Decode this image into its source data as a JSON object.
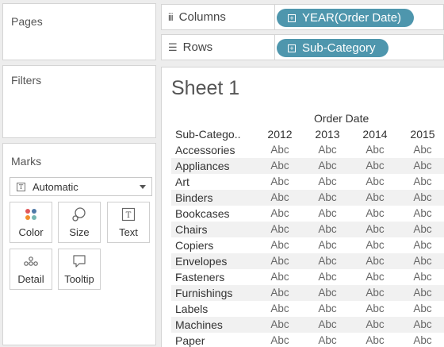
{
  "pages": {
    "title": "Pages"
  },
  "filters": {
    "title": "Filters"
  },
  "marks": {
    "title": "Marks",
    "mark_type": "Automatic",
    "buttons": [
      "Color",
      "Size",
      "Text",
      "Detail",
      "Tooltip"
    ]
  },
  "shelves": {
    "columns_label": "Columns",
    "columns_pill": "YEAR(Order Date)",
    "rows_label": "Rows",
    "rows_pill": "Sub-Category",
    "pill_color": "#4e96ad"
  },
  "view": {
    "sheet_title": "Sheet 1",
    "column_group_header": "Order Date",
    "row_header": "Sub-Catego..",
    "years": [
      "2012",
      "2013",
      "2014",
      "2015"
    ],
    "cell_text": "Abc",
    "rows": [
      "Accessories",
      "Appliances",
      "Art",
      "Binders",
      "Bookcases",
      "Chairs",
      "Copiers",
      "Envelopes",
      "Fasteners",
      "Furnishings",
      "Labels",
      "Machines",
      "Paper"
    ],
    "band_color": "#f1f1f1"
  }
}
